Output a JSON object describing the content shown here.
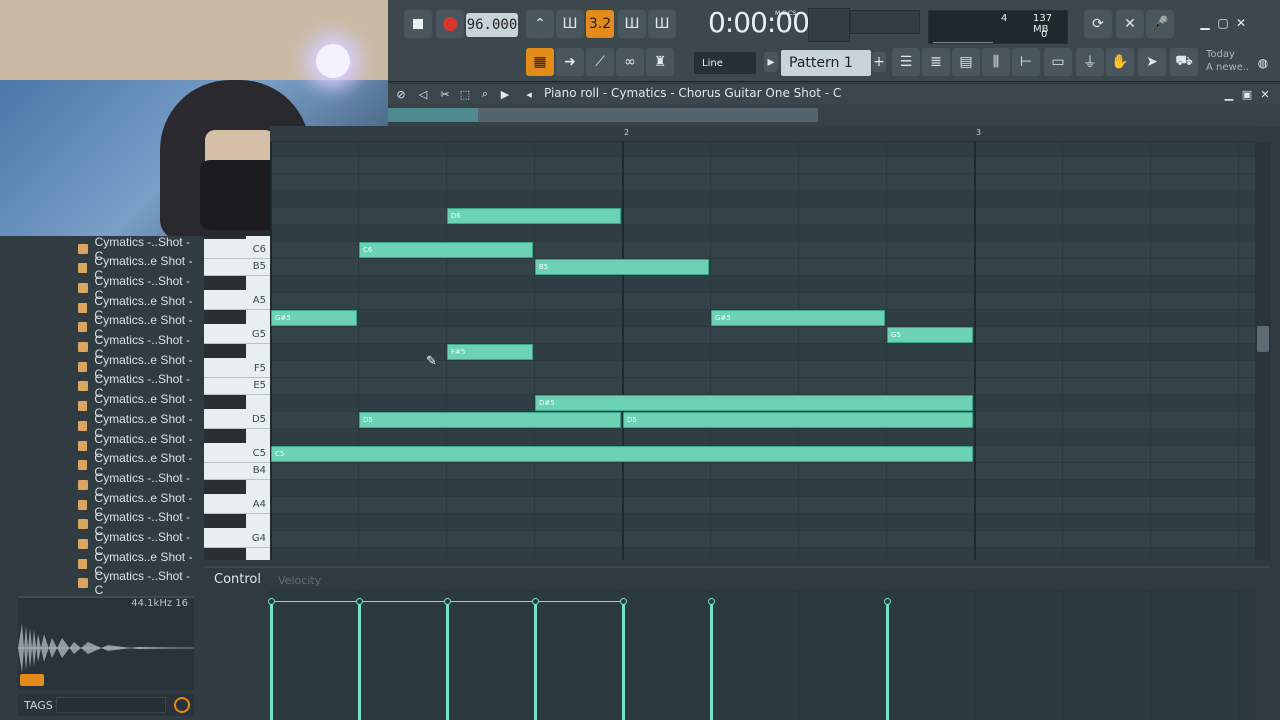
{
  "toolbar": {
    "tempo": "96.000",
    "time": "0:00:00",
    "time_unit": "M:S:CS",
    "pattern": "Pattern 1",
    "snap": "Line",
    "voices": "4",
    "memory": "137 MB",
    "zero": "0",
    "news_title": "Today",
    "news_text": "A newe..",
    "pat_btn_label": "3.2"
  },
  "piano_roll": {
    "title": "Piano roll - Cymatics - Chorus Guitar One Shot - C",
    "bars": [
      "2",
      "3"
    ]
  },
  "keyboard": {
    "labels": [
      "C6",
      "B5",
      "A5",
      "G5",
      "F5",
      "E5",
      "D5",
      "C5",
      "B4",
      "A4",
      "G4"
    ]
  },
  "notes": [
    {
      "label": "D6",
      "start": 1.5,
      "length": 0.5,
      "pitch": "D6"
    },
    {
      "label": "C6",
      "start": 1.25,
      "length": 0.5,
      "pitch": "C6"
    },
    {
      "label": "B5",
      "start": 1.75,
      "length": 0.5,
      "pitch": "B5"
    },
    {
      "label": "G#5",
      "start": 1.0,
      "length": 0.25,
      "pitch": "G#5"
    },
    {
      "label": "G#5",
      "start": 2.25,
      "length": 0.5,
      "pitch": "G#5"
    },
    {
      "label": "G5",
      "start": 2.75,
      "length": 0.25,
      "pitch": "G5"
    },
    {
      "label": "F#5",
      "start": 1.5,
      "length": 0.25,
      "pitch": "F#5"
    },
    {
      "label": "D#5",
      "start": 1.75,
      "length": 1.25,
      "pitch": "D#5"
    },
    {
      "label": "D5",
      "start": 1.25,
      "length": 0.75,
      "pitch": "D5"
    },
    {
      "label": "D5",
      "start": 2.0,
      "length": 1.0,
      "pitch": "D5"
    },
    {
      "label": "C5",
      "start": 1.0,
      "length": 2.0,
      "pitch": "C5"
    }
  ],
  "control": {
    "label": "Control",
    "target": "Velocity"
  },
  "browser": {
    "items": [
      "Cymatics -..Shot - C",
      "Cymatics..e Shot - C",
      "Cymatics -..Shot - C",
      "Cymatics..e Shot - C",
      "Cymatics..e Shot - C",
      "Cymatics -..Shot - C",
      "Cymatics..e Shot - C",
      "Cymatics -..Shot - C",
      "Cymatics..e Shot - C",
      "Cymatics..e Shot - C",
      "Cymatics..e Shot - C",
      "Cymatics..e Shot - C",
      "Cymatics -..Shot - C",
      "Cymatics..e Shot - C",
      "Cymatics -..Shot - C",
      "Cymatics -..Shot - C",
      "Cymatics..e Shot - C",
      "Cymatics -..Shot - C"
    ],
    "sample_rate": "44.1kHz 16",
    "tags": "TAGS"
  },
  "colors": {
    "note": "#6dd1b4",
    "accent": "#e28a1a",
    "grid": "#34434a"
  }
}
